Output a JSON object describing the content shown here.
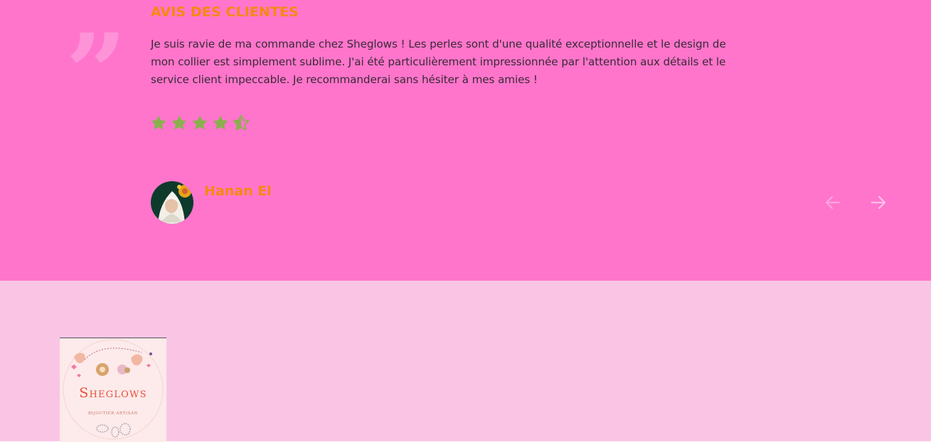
{
  "testimonials": {
    "title": "AVIS DES CLIENTES",
    "quote_icon": "quote-icon",
    "review_text": "Je suis ravie de ma commande chez Sheglows ! Les perles sont d'une qualité exceptionnelle et le design de mon collier est simplement sublime. J'ai été particulièrement impressionnée par l'attention aux détails et le service client impeccable. Je recommanderai sans hésiter à mes amies !",
    "rating": 4.5,
    "rating_max": 5,
    "author_name": "Hanan El",
    "nav": {
      "prev_icon": "arrow-left-icon",
      "next_icon": "arrow-right-icon"
    }
  },
  "footer": {
    "logo": {
      "brand": "Sheglows",
      "tagline": "BIJOUTIER ARTISAN"
    }
  },
  "colors": {
    "testimonial_bg": "#ff75cc",
    "footer_bg": "#fac5e5",
    "accent": "#f5890f",
    "star": "#8ab04d",
    "text": "#3a2a35"
  }
}
